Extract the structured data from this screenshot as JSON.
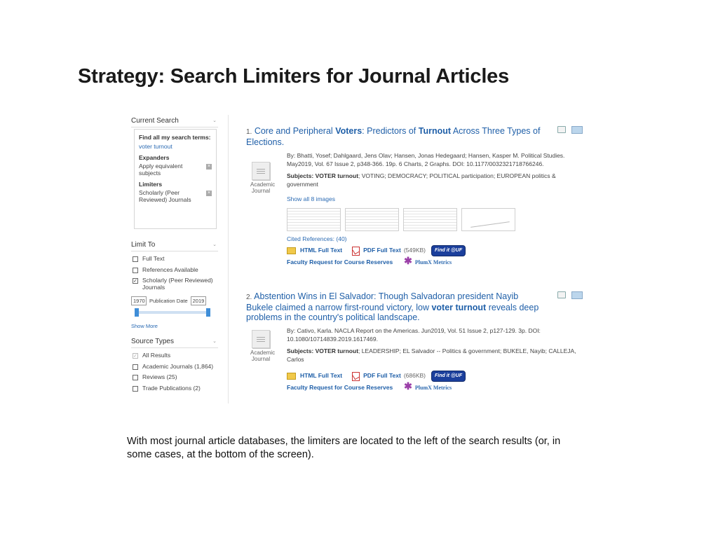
{
  "slide": {
    "title": "Strategy: Search Limiters for Journal Articles",
    "caption": "With most journal article databases, the limiters are located to the left of the search results (or, in some cases, at the bottom of the screen)."
  },
  "sidebar": {
    "current_search": {
      "heading": "Current Search",
      "find_label": "Find all my search terms:",
      "query": "voter turnout",
      "expanders_label": "Expanders",
      "expander_item": "Apply equivalent subjects",
      "limiters_label": "Limiters",
      "limiter_item": "Scholarly (Peer Reviewed) Journals"
    },
    "limit_to": {
      "heading": "Limit To",
      "options": [
        {
          "label": "Full Text",
          "checked": false
        },
        {
          "label": "References Available",
          "checked": false
        },
        {
          "label": "Scholarly (Peer Reviewed) Journals",
          "checked": true
        }
      ],
      "date_from": "1970",
      "date_label": "Publication Date",
      "date_to": "2019",
      "slider_range": [
        0,
        1
      ],
      "show_more": "Show More"
    },
    "source_types": {
      "heading": "Source Types",
      "options": [
        {
          "label": "All Results",
          "checked": true
        },
        {
          "label": "Academic Journals (1,864)",
          "checked": false
        },
        {
          "label": "Reviews (25)",
          "checked": false
        },
        {
          "label": "Trade Publications (2)",
          "checked": false
        }
      ]
    }
  },
  "results": [
    {
      "number": "1.",
      "title_parts": [
        "Core and Peripheral ",
        "Voters",
        ": Predictors of ",
        "Turnout",
        " Across Three Types of Elections."
      ],
      "authors": "By: Bhatti, Yosef; Dahlgaard, Jens Olav; Hansen, Jonas Hedegaard; Hansen, Kasper M. Political Studies. May2019, Vol. 67 Issue 2, p348-366. 19p. 6 Charts, 2 Graphs. DOI: 10.1177/0032321718766246.",
      "doc_type": "Academic Journal",
      "subjects_label": "Subjects:",
      "subjects_bold": "VOTER turnout",
      "subjects_rest": "; VOTING; DEMOCRACY; POLITICAL participation; EUROPEAN politics & government",
      "show_images": "Show all 8 images",
      "cited": "Cited References: (40)",
      "html_label": "HTML Full Text",
      "pdf_label": "PDF Full Text",
      "pdf_size": "(549KB)",
      "findit": "Find it @UF",
      "request": "Faculty Request for Course Reserves",
      "plumx": "PlumX Metrics"
    },
    {
      "number": "2.",
      "title_parts": [
        "Abstention Wins in El Salvador: Though Salvadoran president Nayib Bukele claimed a narrow first-round victory, low ",
        "voter turnout",
        " reveals deep problems in the country's political landscape."
      ],
      "authors": "By: Cativo, Karla. NACLA Report on the Americas. Jun2019, Vol. 51 Issue 2, p127-129. 3p. DOI: 10.1080/10714839.2019.1617469.",
      "doc_type": "Academic Journal",
      "subjects_label": "Subjects:",
      "subjects_bold": "VOTER turnout",
      "subjects_rest": "; LEADERSHIP; EL Salvador -- Politics & government; BUKELE, Nayib; CALLEJA, Carlos",
      "html_label": "HTML Full Text",
      "pdf_label": "PDF Full Text",
      "pdf_size": "(686KB)",
      "findit": "Find it @UF",
      "request": "Faculty Request for Course Reserves",
      "plumx": "PlumX Metrics"
    }
  ]
}
